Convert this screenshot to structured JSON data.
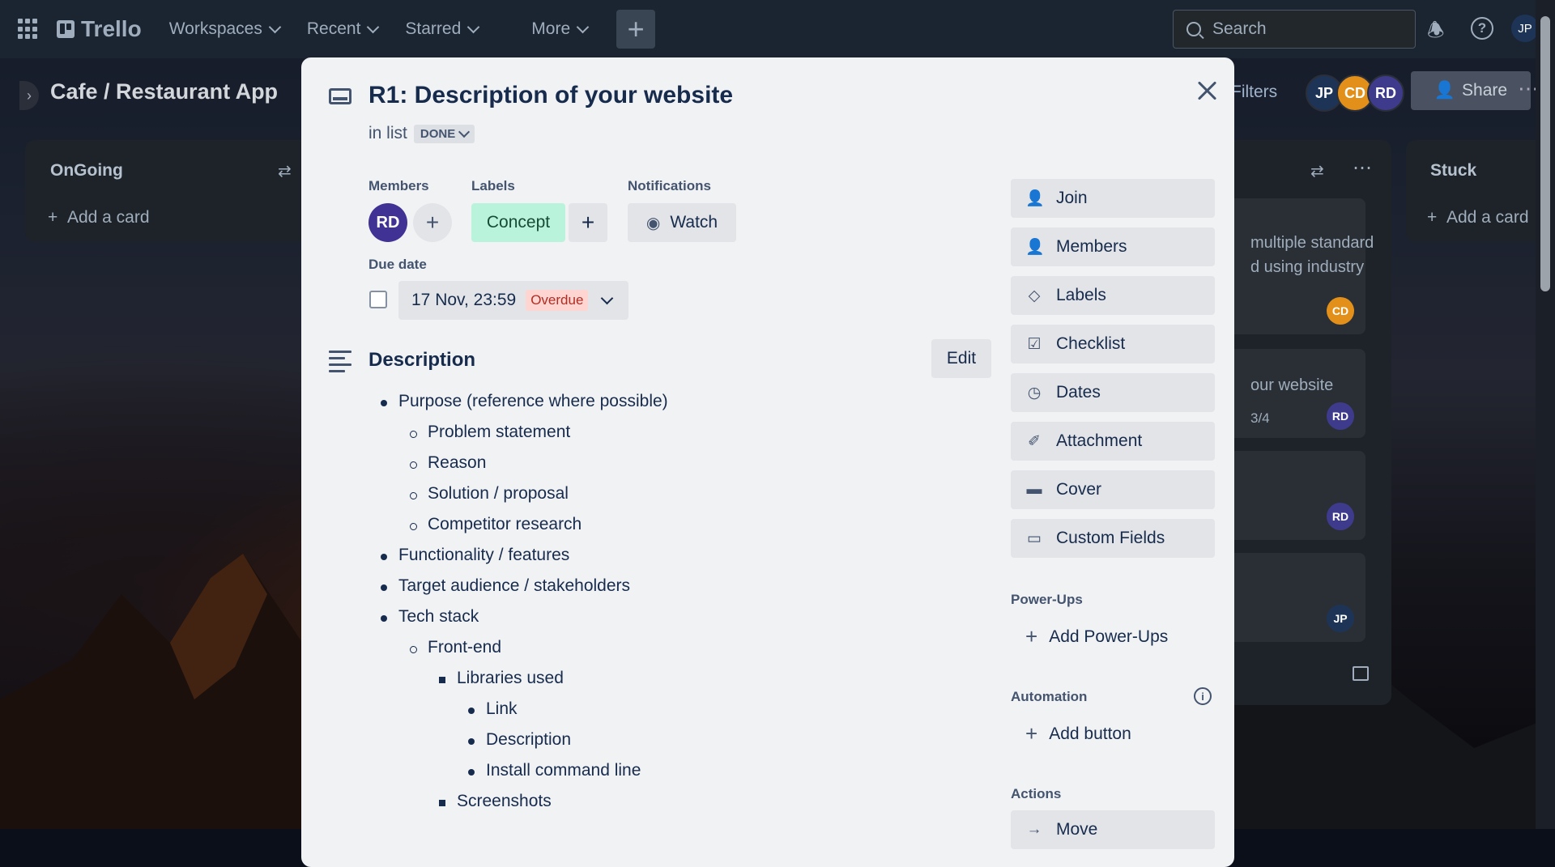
{
  "header": {
    "logo": "Trello",
    "nav": [
      "Workspaces",
      "Recent",
      "Starred",
      "More"
    ],
    "create_label": "+",
    "search_placeholder": "Search",
    "avatar": "JP"
  },
  "board": {
    "title": "Cafe / Restaurant App",
    "filters_label": "Filters",
    "members": [
      {
        "initials": "JP",
        "color": "#1d3456"
      },
      {
        "initials": "CD",
        "color": "#e2901a"
      },
      {
        "initials": "RD",
        "color": "#3f3b8c"
      }
    ],
    "share_label": "Share"
  },
  "lists": {
    "ongoing": {
      "title": "OnGoing",
      "add": "Add a card"
    },
    "stuck": {
      "title": "Stuck",
      "add": "Add a card"
    },
    "done_cards": [
      {
        "text": "multiple standard\nd using industry",
        "avatar": "CD",
        "color": "#e2901a"
      },
      {
        "text": "our website",
        "meta": "3/4",
        "avatar": "RD",
        "color": "#3f3b8c"
      },
      {
        "text": "",
        "avatar": "RD",
        "color": "#3f3b8c"
      },
      {
        "text": "",
        "avatar": "JP",
        "color": "#1d3456"
      }
    ]
  },
  "modal": {
    "title": "R1: Description of your website",
    "in_list_prefix": "in list",
    "list_name": "DONE",
    "members_label": "Members",
    "member": "RD",
    "labels_label": "Labels",
    "label_name": "Concept",
    "label_color": "#baf3db",
    "notifications_label": "Notifications",
    "watch_label": "Watch",
    "due_label": "Due date",
    "due_value": "17 Nov, 23:59",
    "overdue_label": "Overdue",
    "description_title": "Description",
    "edit_label": "Edit",
    "description": [
      {
        "level": 0,
        "text": "Purpose (reference where possible)"
      },
      {
        "level": 1,
        "text": "Problem statement"
      },
      {
        "level": 1,
        "text": "Reason"
      },
      {
        "level": 1,
        "text": "Solution / proposal"
      },
      {
        "level": 1,
        "text": "Competitor research"
      },
      {
        "level": 0,
        "text": "Functionality / features"
      },
      {
        "level": 0,
        "text": "Target audience / stakeholders"
      },
      {
        "level": 0,
        "text": "Tech stack"
      },
      {
        "level": 1,
        "text": "Front-end"
      },
      {
        "level": 2,
        "text": "Libraries used"
      },
      {
        "level": 3,
        "text": "Link"
      },
      {
        "level": 3,
        "text": "Description"
      },
      {
        "level": 3,
        "text": "Install command line"
      },
      {
        "level": 2,
        "text": "Screenshots"
      }
    ],
    "sidebar": {
      "buttons": [
        {
          "label": "Join",
          "icon": "person-plus-icon"
        },
        {
          "label": "Members",
          "icon": "person-icon"
        },
        {
          "label": "Labels",
          "icon": "tag-icon"
        },
        {
          "label": "Checklist",
          "icon": "checkbox-icon"
        },
        {
          "label": "Dates",
          "icon": "clock-icon"
        },
        {
          "label": "Attachment",
          "icon": "paperclip-icon"
        },
        {
          "label": "Cover",
          "icon": "cover-icon"
        },
        {
          "label": "Custom Fields",
          "icon": "field-icon"
        }
      ],
      "powerups_label": "Power-Ups",
      "add_powerups": "Add Power-Ups",
      "automation_label": "Automation",
      "add_button": "Add button",
      "actions_label": "Actions",
      "move_label": "Move"
    }
  }
}
